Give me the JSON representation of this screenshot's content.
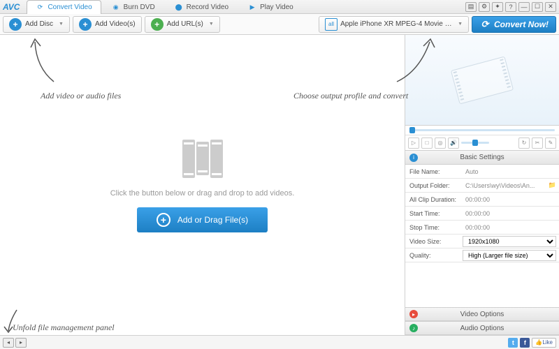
{
  "app": {
    "logo": "AVC"
  },
  "titlebar_icons": [
    "file",
    "gear",
    "wrench",
    "help",
    "min",
    "max",
    "close"
  ],
  "tabs": [
    {
      "label": "Convert Video",
      "active": true
    },
    {
      "label": "Burn DVD",
      "active": false
    },
    {
      "label": "Record Video",
      "active": false
    },
    {
      "label": "Play Video",
      "active": false
    }
  ],
  "toolbar": {
    "add_disc": "Add Disc",
    "add_videos": "Add Video(s)",
    "add_urls": "Add URL(s)",
    "profile": "Apple iPhone XR MPEG-4 Movie (*.m...",
    "convert": "Convert Now!"
  },
  "workspace": {
    "hint": "Click the button below or drag and drop to add videos.",
    "add_button": "Add or Drag File(s)"
  },
  "annotations": {
    "add": "Add video or audio files",
    "choose": "Choose output profile and convert",
    "unfold": "Unfold file management panel"
  },
  "panels": {
    "basic": "Basic Settings",
    "video_options": "Video Options",
    "audio_options": "Audio Options"
  },
  "settings": {
    "file_name": {
      "label": "File Name:",
      "value": "Auto"
    },
    "output_folder": {
      "label": "Output Folder:",
      "value": "C:\\Users\\wy\\Videos\\An..."
    },
    "all_clip": {
      "label": "All Clip Duration:",
      "value": "00:00:00"
    },
    "start_time": {
      "label": "Start Time:",
      "value": "00:00:00"
    },
    "stop_time": {
      "label": "Stop Time:",
      "value": "00:00:00"
    },
    "video_size": {
      "label": "Video Size:",
      "value": "1920x1080"
    },
    "quality": {
      "label": "Quality:",
      "value": "High (Larger file size)"
    }
  },
  "social": {
    "like": "Like"
  }
}
